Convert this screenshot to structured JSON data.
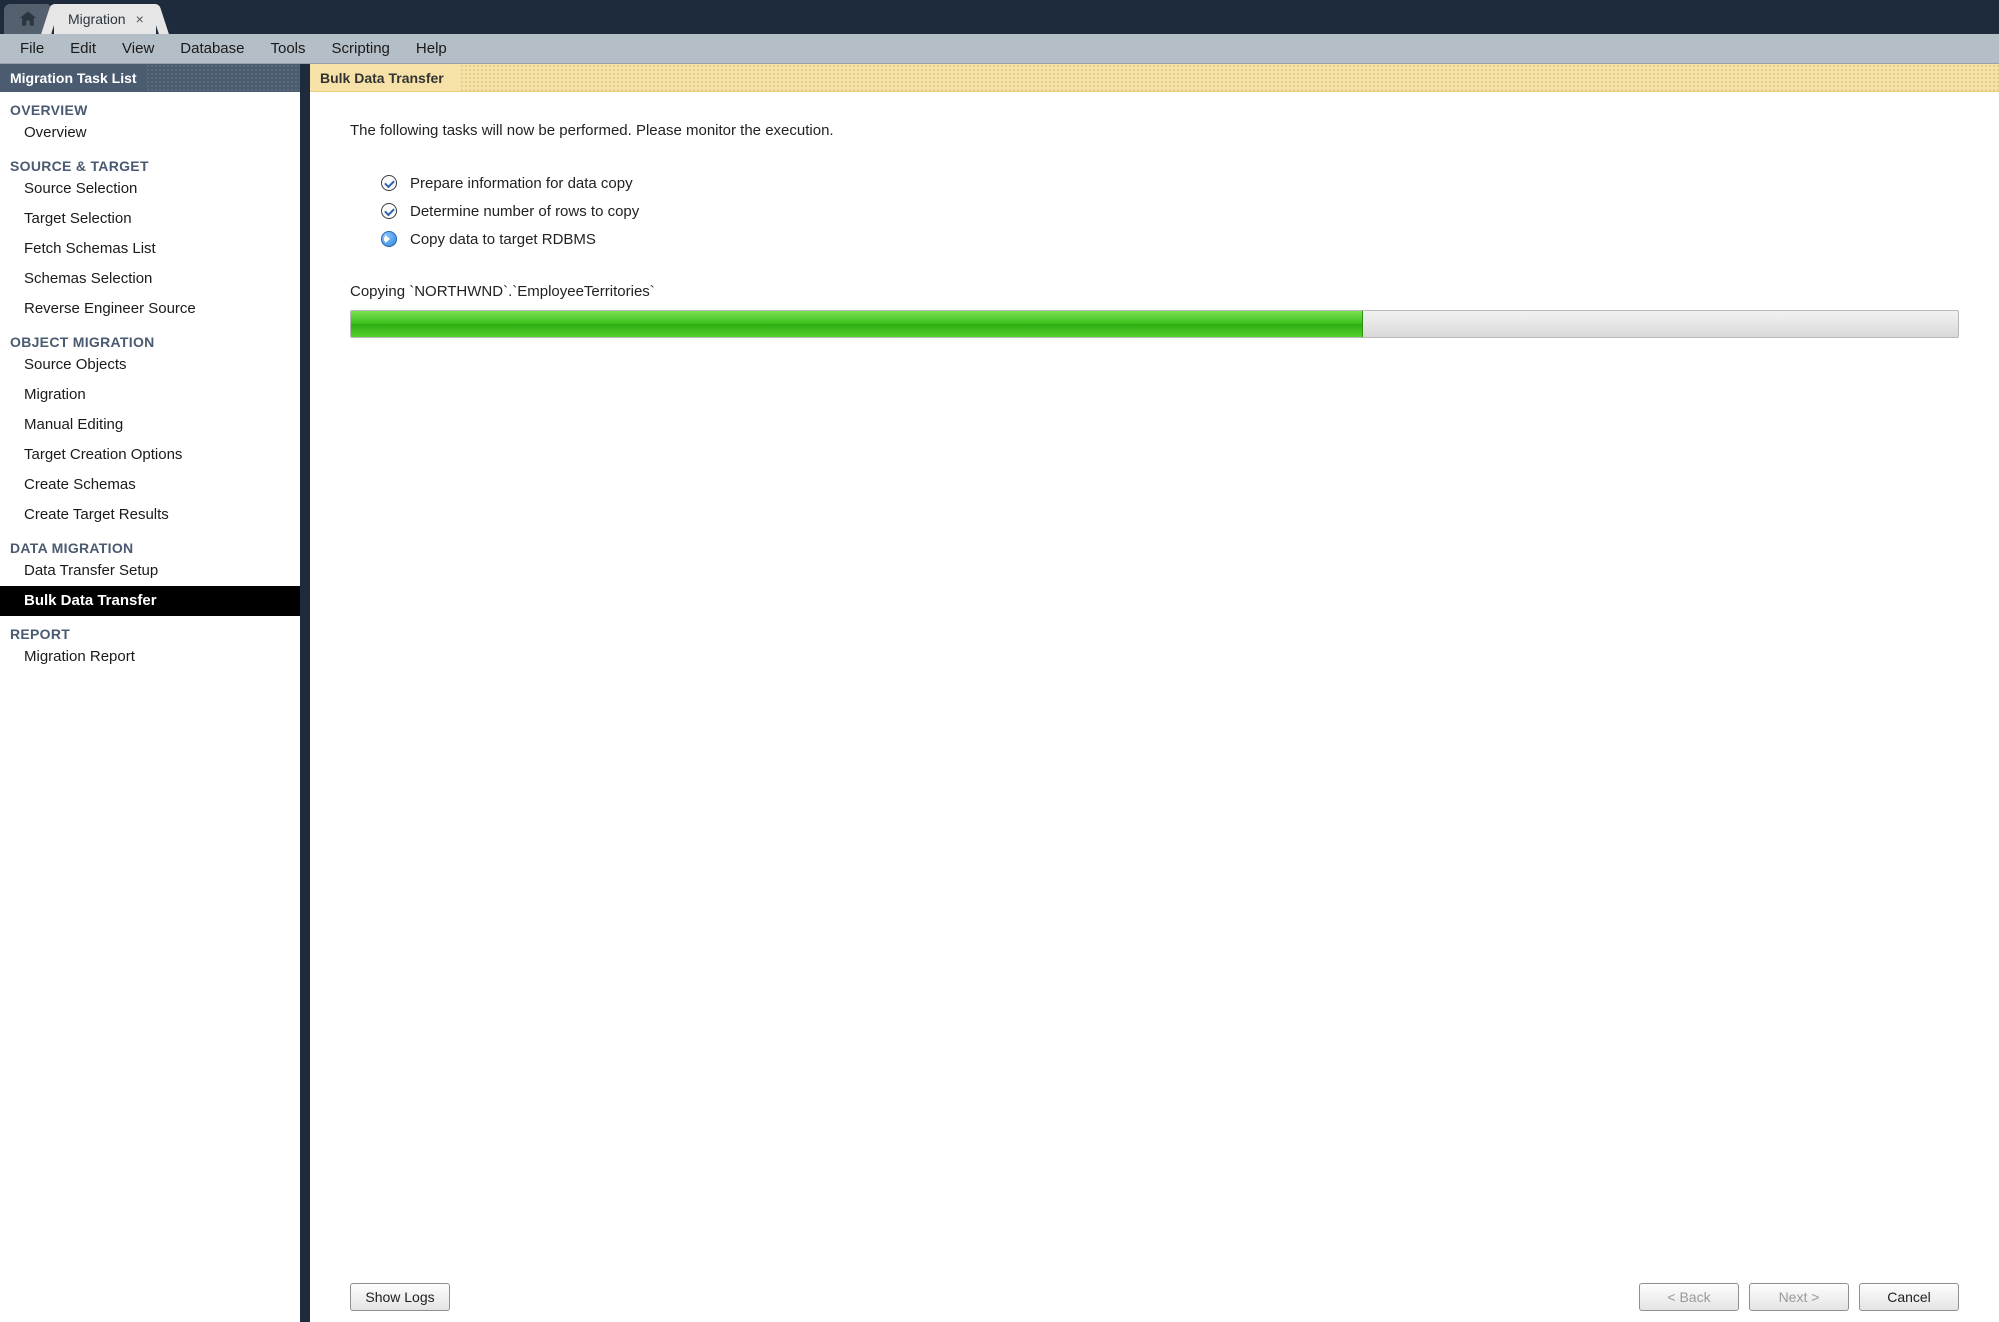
{
  "tab": {
    "title": "Migration"
  },
  "menu": {
    "items": [
      "File",
      "Edit",
      "View",
      "Database",
      "Tools",
      "Scripting",
      "Help"
    ]
  },
  "sidebar": {
    "title": "Migration Task List",
    "sections": [
      {
        "heading": "OVERVIEW",
        "items": [
          "Overview"
        ]
      },
      {
        "heading": "SOURCE & TARGET",
        "items": [
          "Source Selection",
          "Target Selection",
          "Fetch Schemas List",
          "Schemas Selection",
          "Reverse Engineer Source"
        ]
      },
      {
        "heading": "OBJECT MIGRATION",
        "items": [
          "Source Objects",
          "Migration",
          "Manual Editing",
          "Target Creation Options",
          "Create Schemas",
          "Create Target Results"
        ]
      },
      {
        "heading": "DATA MIGRATION",
        "items": [
          "Data Transfer Setup",
          "Bulk Data Transfer"
        ]
      },
      {
        "heading": "REPORT",
        "items": [
          "Migration Report"
        ]
      }
    ],
    "active": "Bulk Data Transfer"
  },
  "main": {
    "header": "Bulk Data Transfer",
    "intro": "The following tasks will now be performed. Please monitor the execution.",
    "tasks": [
      {
        "status": "done",
        "label": "Prepare information for data copy"
      },
      {
        "status": "done",
        "label": "Determine number of rows to copy"
      },
      {
        "status": "running",
        "label": "Copy data to target RDBMS"
      }
    ],
    "status_text": "Copying `NORTHWND`.`EmployeeTerritories`",
    "progress_percent": 63
  },
  "footer": {
    "show_logs": "Show Logs",
    "back": "< Back",
    "next": "Next >",
    "cancel": "Cancel"
  }
}
